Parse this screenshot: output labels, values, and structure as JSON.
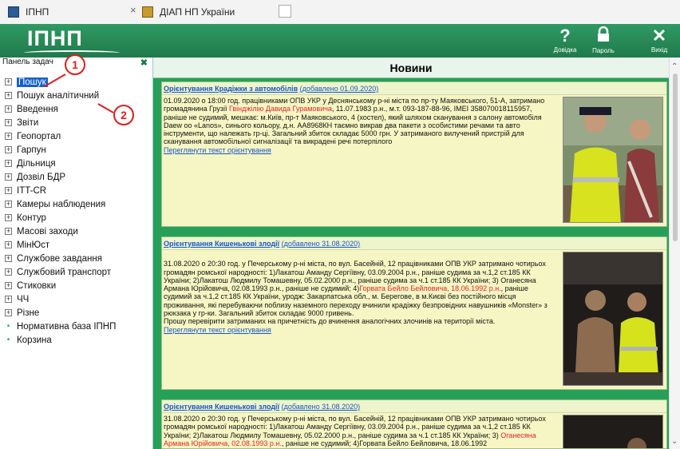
{
  "browser": {
    "tabs": [
      {
        "title": "ІПНП",
        "close": "×"
      },
      {
        "title": "ДІАП НП України"
      }
    ]
  },
  "header": {
    "logo": "ІПНП",
    "buttons": [
      {
        "icon": "?",
        "label": "Довідка"
      },
      {
        "icon": "🔒",
        "label": "Пароль"
      },
      {
        "icon": "✕",
        "label": "Вихід"
      }
    ]
  },
  "sidebar": {
    "title": "Панель задач",
    "close": "✖",
    "items": [
      {
        "label": "Пошук",
        "kind": "plus",
        "selected": true
      },
      {
        "label": "Пошук аналітичний",
        "kind": "plus"
      },
      {
        "label": "Введення",
        "kind": "plus"
      },
      {
        "label": "Звіти",
        "kind": "plus"
      },
      {
        "label": "Геопортал",
        "kind": "plus"
      },
      {
        "label": "Гарпун",
        "kind": "plus"
      },
      {
        "label": "Дільниця",
        "kind": "plus"
      },
      {
        "label": "Дозвіл БДР",
        "kind": "plus"
      },
      {
        "label": "ITT-CR",
        "kind": "plus"
      },
      {
        "label": "Камеры наблюдения",
        "kind": "plus"
      },
      {
        "label": "Контур",
        "kind": "plus"
      },
      {
        "label": "Масові заходи",
        "kind": "plus"
      },
      {
        "label": "МінЮст",
        "kind": "plus"
      },
      {
        "label": "Службове завдання",
        "kind": "plus"
      },
      {
        "label": "Службовий транспорт",
        "kind": "plus"
      },
      {
        "label": "Стиковки",
        "kind": "plus"
      },
      {
        "label": "ЧЧ",
        "kind": "plus"
      },
      {
        "label": "Різне",
        "kind": "plus"
      },
      {
        "label": "Нормативна база ІПНП",
        "kind": "dot"
      },
      {
        "label": "Корзина",
        "kind": "dot"
      }
    ],
    "callouts": [
      "1",
      "2"
    ]
  },
  "main": {
    "title": "Новини",
    "news": [
      {
        "title": "Орієнтування Крадіжки з автомобілів",
        "added": "(добавлено 01.09.2020)",
        "text_a": "01.09.2020 о 18:00 год. працівниками ОПВ УКР у Деснянському р-ні міста по пр-ту Маяковського, 51-А, затримано громадянина Грузії ",
        "text_red": "Гвінджілію Давида Гурамовича",
        "text_b": ", 11.07.1983 р.н., м.т. 093-187-88-96, IMEI 358070018115957, раніше не судимий, мешкає: м.Київ, пр-т Маяковського, 4 (хостел), який шляхом сканування з салону автомобіля Daew oo «Lanos», синього кольору, д.н. АА8968КН таємно викрав два пакети з особистими речами та авто інструменти, що належать гр-ці. Загальний збиток складає 5000 грн. У затриманого вилучений пристрій для сканування автомобільної сигналізації та викрадені речі потерпілого",
        "link": "Переглянути текст орієнтування"
      },
      {
        "title": "Орієнтування Кишенькові злодії",
        "added": "(добавлено 31.08.2020)",
        "text_a": "31.08.2020 о 20:30 год. у Печерському р-ні міста, по вул. Басейній, 12 працівниками ОПВ УКР затримано чотирьох громадян ромської народності: 1)Лакатош Аманду Сергіївну, 03.09.2004 р.н., раніше судима за ч.1,2 ст.185 КК України; 2)Лакатош Людмилу Томашевну, 05.02.2000 р.н., раніше судима за ч.1 ст.185 КК України; 3) Оганесяна Армана Юрійовича, 02.08.1993 р.н., раніше не судимий; 4)",
        "text_red": "Горвата Бейло Бейловича, 18.06.1992 р.н.",
        "text_b": ", раніше судимий за ч.1,2 ст.185 КК України, уродж: Закарпатська обл., м. Берегове, в м.Києві без постійного місця проживання, які перебуваючи поблизу наземного переходу вчинили крадіжку безпровідних навушників «Monster» з рюкзака у гр-ки. Загальний збиток складає 9000 гривень.\nПрошу перевірити затриманих на причетність до вчинення аналогічних злочинів на території міста.",
        "link": "Переглянути текст орієнтування"
      },
      {
        "title": "Орієнтування Кишенькові злодії",
        "added": "(добавлено 31.08.2020)",
        "text_a": "31.08.2020 о 20:30 год. у Печерському р-ні міста, по вул. Басейній, 12 працівниками ОПВ УКР затримано чотирьох громадян ромської народності: 1)Лакатош Аманду Сергіївну, 03.09.2004 р.н., раніше судима за ч.1,2 ст.185 КК України; 2)Лакатош Людмилу Томашевну, 05.02.2000 р.н., раніше судима за ч.1 ст.185 КК України; 3) ",
        "text_red": "Оганесяна Армана Юрійовича, 02.08.1993 р.н.",
        "text_b": ", раніше не судимий; 4)Горвата Бейло Бейловича, 18.06.1992",
        "link": ""
      }
    ]
  },
  "colors": {
    "header": "#1f7a4b",
    "panel": "#26a058",
    "card": "#f6f6c4",
    "link": "#1a55c8",
    "highlight": "#e0242a",
    "callout": "#d82020"
  }
}
